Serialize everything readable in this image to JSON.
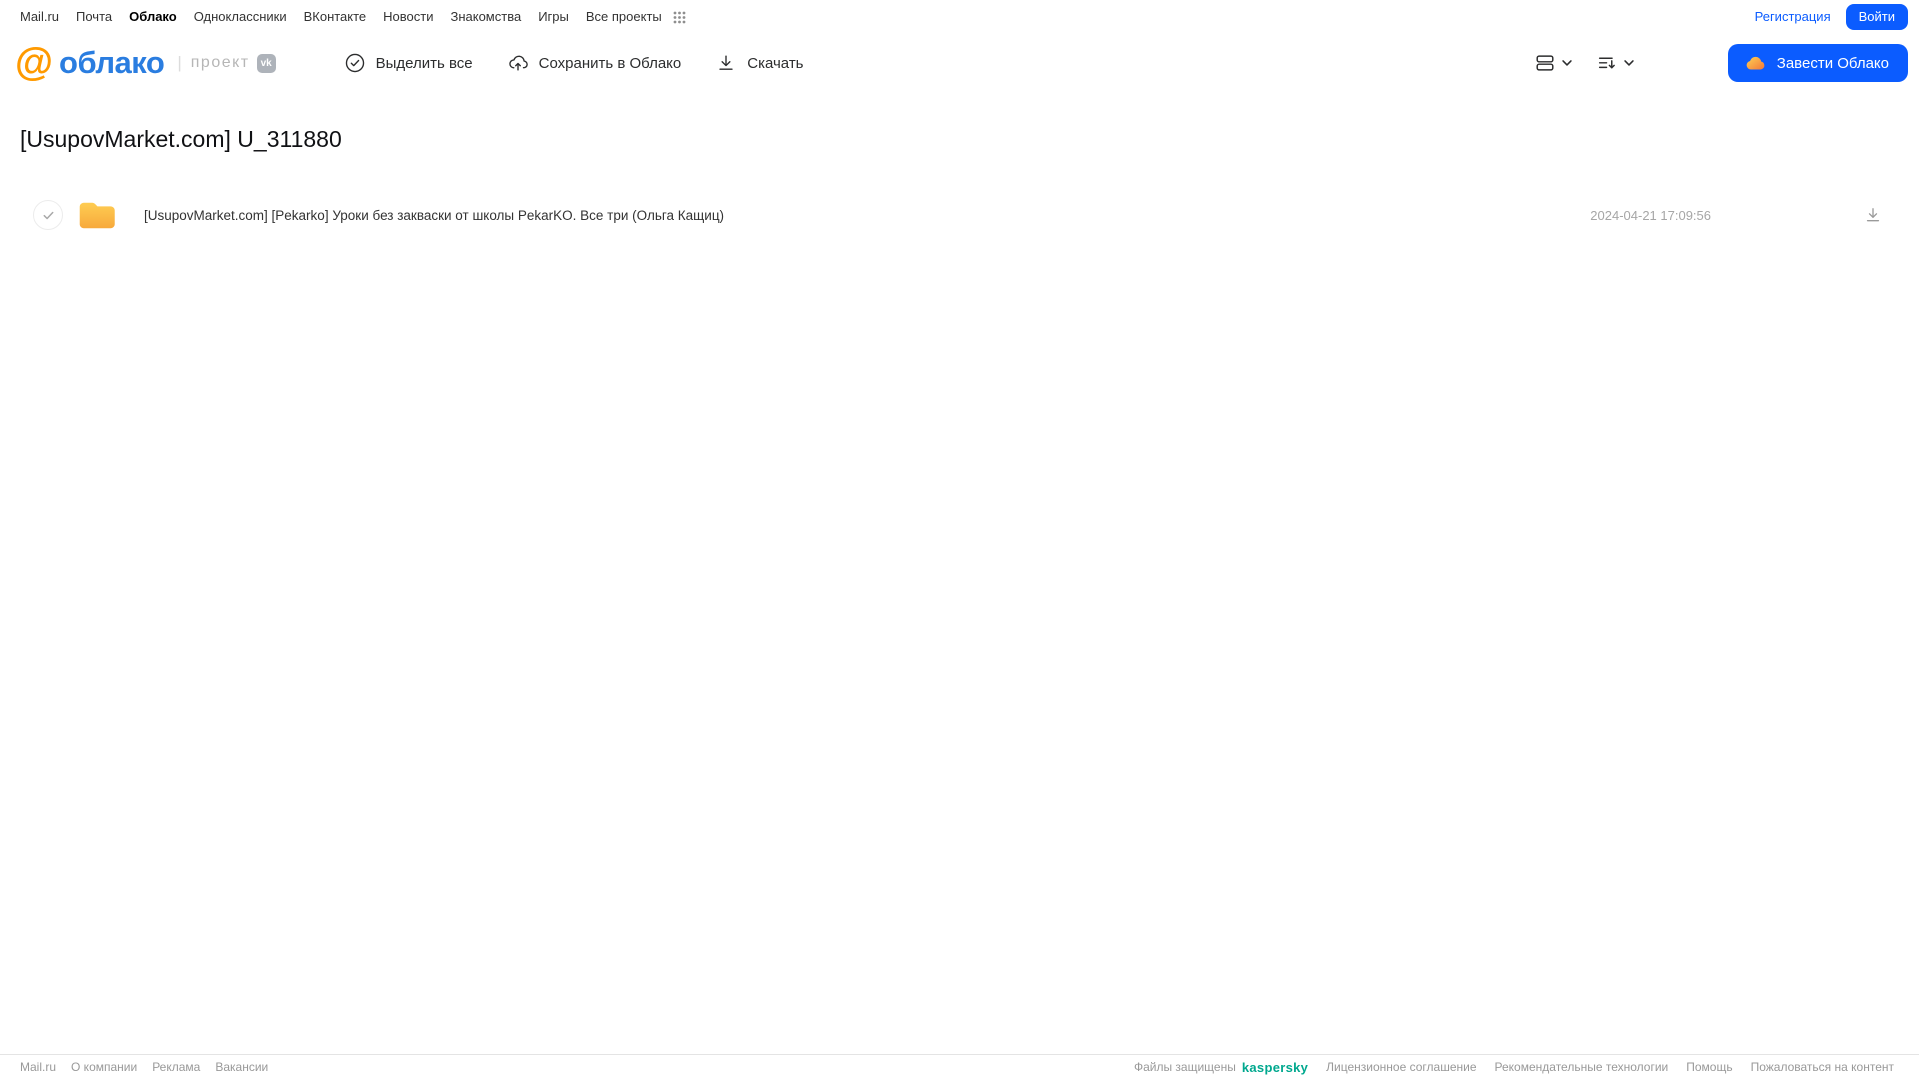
{
  "topbar": {
    "links": [
      "Mail.ru",
      "Почта",
      "Облако",
      "Одноклассники",
      "ВКонтакте",
      "Новости",
      "Знакомства",
      "Игры",
      "Все проекты"
    ],
    "active_link": "Облако",
    "register_label": "Регистрация",
    "login_label": "Войти"
  },
  "header": {
    "logo_at": "@",
    "logo_text": "облако",
    "logo_divider": "|",
    "project_label": "проект",
    "vk_badge": "vk",
    "toolbar": {
      "select_all": "Выделить все",
      "save_to_cloud": "Сохранить в Облако",
      "download": "Скачать"
    },
    "get_cloud_label": "Завести Облако"
  },
  "main": {
    "title": "[UsupovMarket.com] U_311880",
    "files": [
      {
        "type": "folder",
        "name": "[UsupovMarket.com] [Pekarko] Уроки без закваски от школы PekarKO. Все три (Ольга Кащиц)",
        "date": "2024-04-21 17:09:56"
      }
    ]
  },
  "footer": {
    "left_links": [
      "Mail.ru",
      "О компании",
      "Реклама",
      "Вакансии"
    ],
    "protected_label": "Файлы защищены",
    "kaspersky_label": "kaspersky",
    "right_links": [
      "Лицензионное соглашение",
      "Рекомендательные технологии",
      "Помощь",
      "Пожаловаться на контент"
    ]
  },
  "colors": {
    "accent_blue": "#0b5cff",
    "logo_orange": "#ff9a00",
    "logo_blue": "#2a7de0",
    "folder_yellow_top": "#ffcd52",
    "folder_yellow_bottom": "#f7a93c",
    "kaspersky_green": "#00a88e"
  }
}
